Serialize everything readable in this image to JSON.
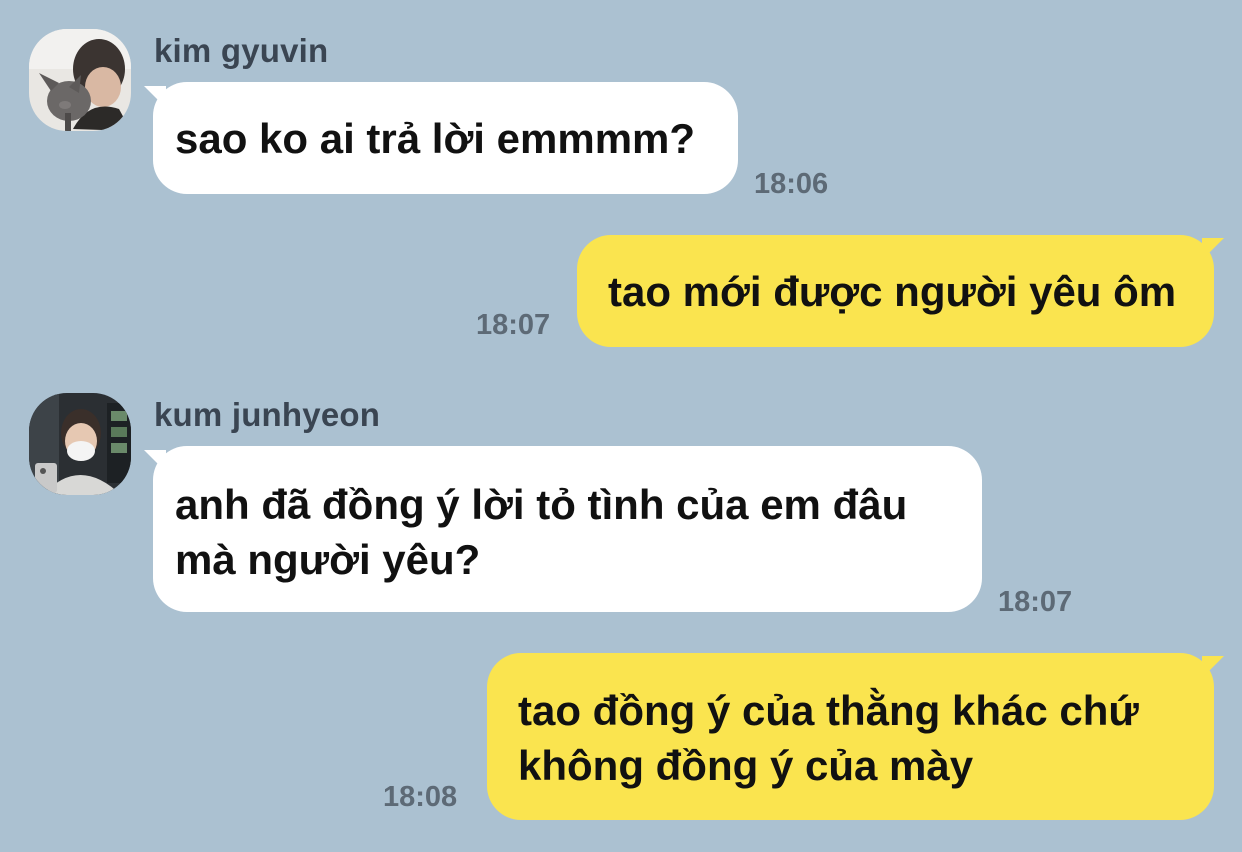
{
  "colors": {
    "background": "#abc1d1",
    "incoming_bubble": "#ffffff",
    "outgoing_bubble": "#fae44f",
    "sender_name": "#3a4552",
    "timestamp": "#5d6a76"
  },
  "messages": [
    {
      "direction": "incoming",
      "sender": "kim gyuvin",
      "avatar_icon": "user-photo-with-dog-icon",
      "lines": [
        "sao ko ai trả lời emmmm?"
      ],
      "time": "18:06"
    },
    {
      "direction": "outgoing",
      "lines": [
        "tao mới được người yêu ôm"
      ],
      "time": "18:07"
    },
    {
      "direction": "incoming",
      "sender": "kum junhyeon",
      "avatar_icon": "user-photo-masked-selfie-icon",
      "lines": [
        "anh đã đồng ý lời tỏ tình của em đâu",
        "mà người yêu?"
      ],
      "time": "18:07"
    },
    {
      "direction": "outgoing",
      "lines": [
        "tao đồng ý của thằng khác chứ",
        "không đồng ý của mày"
      ],
      "time": "18:08"
    }
  ]
}
